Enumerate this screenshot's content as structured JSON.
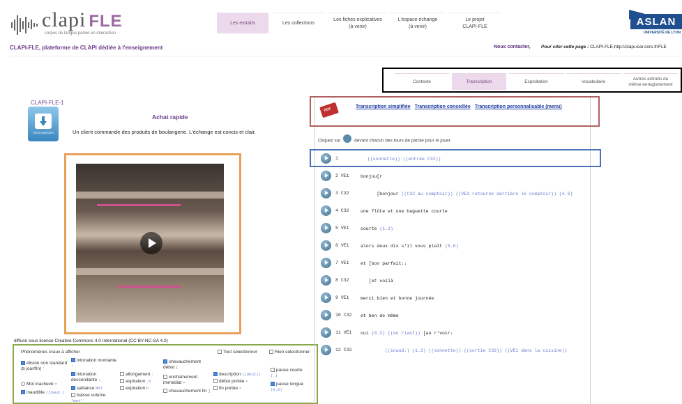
{
  "header": {
    "logo_main": "clapi",
    "logo_fle": "FLE",
    "logo_sub": "corpus de langue parlée en interaction",
    "nav": [
      {
        "label": "Les extraits",
        "active": true
      },
      {
        "label": "Les collections",
        "active": false
      },
      {
        "label": "Les fiches explicatives\n(à venir)",
        "active": false
      },
      {
        "label": "L'espace échange\n(à venir)",
        "active": false
      },
      {
        "label": "Le projet\nCLAPI-FLE",
        "active": false
      }
    ],
    "aslan": "ASLAN",
    "aslan_sub": "UNIVERSITÉ DE LYON"
  },
  "platform_title": "CLAPI-FLE, plateforme de CLAPI dédiée à l'enseignement",
  "contact": "Nous contacter,",
  "cite_label": "Pour citer cette page : ",
  "cite_url": "CLAPI-FLE,http://clapi.icar.cnrs.fr/FLE",
  "tabs": [
    {
      "label": "Contexte",
      "active": false
    },
    {
      "label": "Transcription",
      "active": true
    },
    {
      "label": "Exploitation",
      "active": false
    },
    {
      "label": "Vocabulaire",
      "active": false
    },
    {
      "label": "Autres extraits du\nmême enregistrement",
      "active": false
    }
  ],
  "extract": {
    "id": "CLAPI-FLE-1",
    "download_label": "TÉLÉCHARGER",
    "title": "Achat rapide",
    "description": "Un client commande des produits de boulangerie. L'échange est concis et clair.",
    "license": "diffusé sous licence Creative Commons 4.0 International (CC BY-NC-SA 4.0)"
  },
  "phenomena": {
    "title": "Phénomènes oraux à afficher",
    "select_all": "Tout sélectionner",
    "select_none": "Rien sélectionner",
    "items": [
      {
        "label": "élision non standard (b jour/fin)",
        "sym": "'",
        "on": true
      },
      {
        "label": "Mot inachevé",
        "sym": "=",
        "on": false,
        "radio": true
      },
      {
        "label": "inaudible",
        "sym": "(inaud.)",
        "on": true
      },
      {
        "label": "intonation montante",
        "sym": "↑",
        "on": true
      },
      {
        "label": "intonation descendante",
        "sym": "↓",
        "on": true
      },
      {
        "label": "saillance",
        "sym": "MOT",
        "on": true
      },
      {
        "label": "baisse volume",
        "sym": "°mot°",
        "on": false
      },
      {
        "label": "allongement",
        "sym": ":",
        "on": false
      },
      {
        "label": "aspiration",
        "sym": ".h",
        "on": false
      },
      {
        "label": "expiration",
        "sym": "h",
        "on": false
      },
      {
        "label": "chevauchement début",
        "sym": "[",
        "on": true
      },
      {
        "label": "enchaînement immédiat",
        "sym": "=",
        "on": false
      },
      {
        "label": "chevauchement fin",
        "sym": "]",
        "on": false
      },
      {
        "label": "description",
        "sym": "((DESC))",
        "on": true
      },
      {
        "label": "début portée",
        "sym": "<",
        "on": false
      },
      {
        "label": "fin portée",
        "sym": ">",
        "on": false
      },
      {
        "label": "pause courte",
        "sym": "(.)",
        "on": false
      },
      {
        "label": "pause longue",
        "sym": "(0.0)",
        "on": true
      }
    ]
  },
  "transcription": {
    "links": [
      "Transcription simplifiée",
      "Transcription conseillée",
      "Transcription personnalisable (menu)"
    ],
    "click_before": "Cliquez sur",
    "click_after": "devant chacun des tours de parole pour le jouer",
    "rows": [
      {
        "num": "1",
        "speaker": "",
        "text": "",
        "blue": "((sonnette)) ((entrée C32))"
      },
      {
        "num": "2",
        "speaker": "VE1",
        "text": "bonjou[r",
        "blue": ""
      },
      {
        "num": "3",
        "speaker": "C32",
        "text": "      [bonjour ",
        "blue": "((C32 au comptoir)) ((VE1 retourne derrière le comptoir)) (4.6)"
      },
      {
        "num": "4",
        "speaker": "C32",
        "text": "une flûte et une baguette courte",
        "blue": ""
      },
      {
        "num": "5",
        "speaker": "VE1",
        "text": "courte ",
        "blue": "(1.3)"
      },
      {
        "num": "6",
        "speaker": "VE1",
        "text": "alors deux dix s'il vous plaît ",
        "blue": "(5.6)"
      },
      {
        "num": "7",
        "speaker": "VE1",
        "text": "et [bon parfait↓↓",
        "blue": ""
      },
      {
        "num": "8",
        "speaker": "C32",
        "text": "   [et voilà",
        "blue": ""
      },
      {
        "num": "9",
        "speaker": "VE1",
        "text": "merci bien et bonne journée",
        "blue": ""
      },
      {
        "num": "10",
        "speaker": "C32",
        "text": "et ben de même",
        "blue": ""
      },
      {
        "num": "11",
        "speaker": "VE1",
        "text": "oui ",
        "blue": "(0.2) ((en riant))",
        "text2": " [au r'voir↓"
      },
      {
        "num": "12",
        "speaker": "C32",
        "text": "",
        "blue": "         ((inaud.) (1.2) ((sonnette)) ((sortie C32)) ((VE1 dans la cuisine))"
      }
    ]
  }
}
